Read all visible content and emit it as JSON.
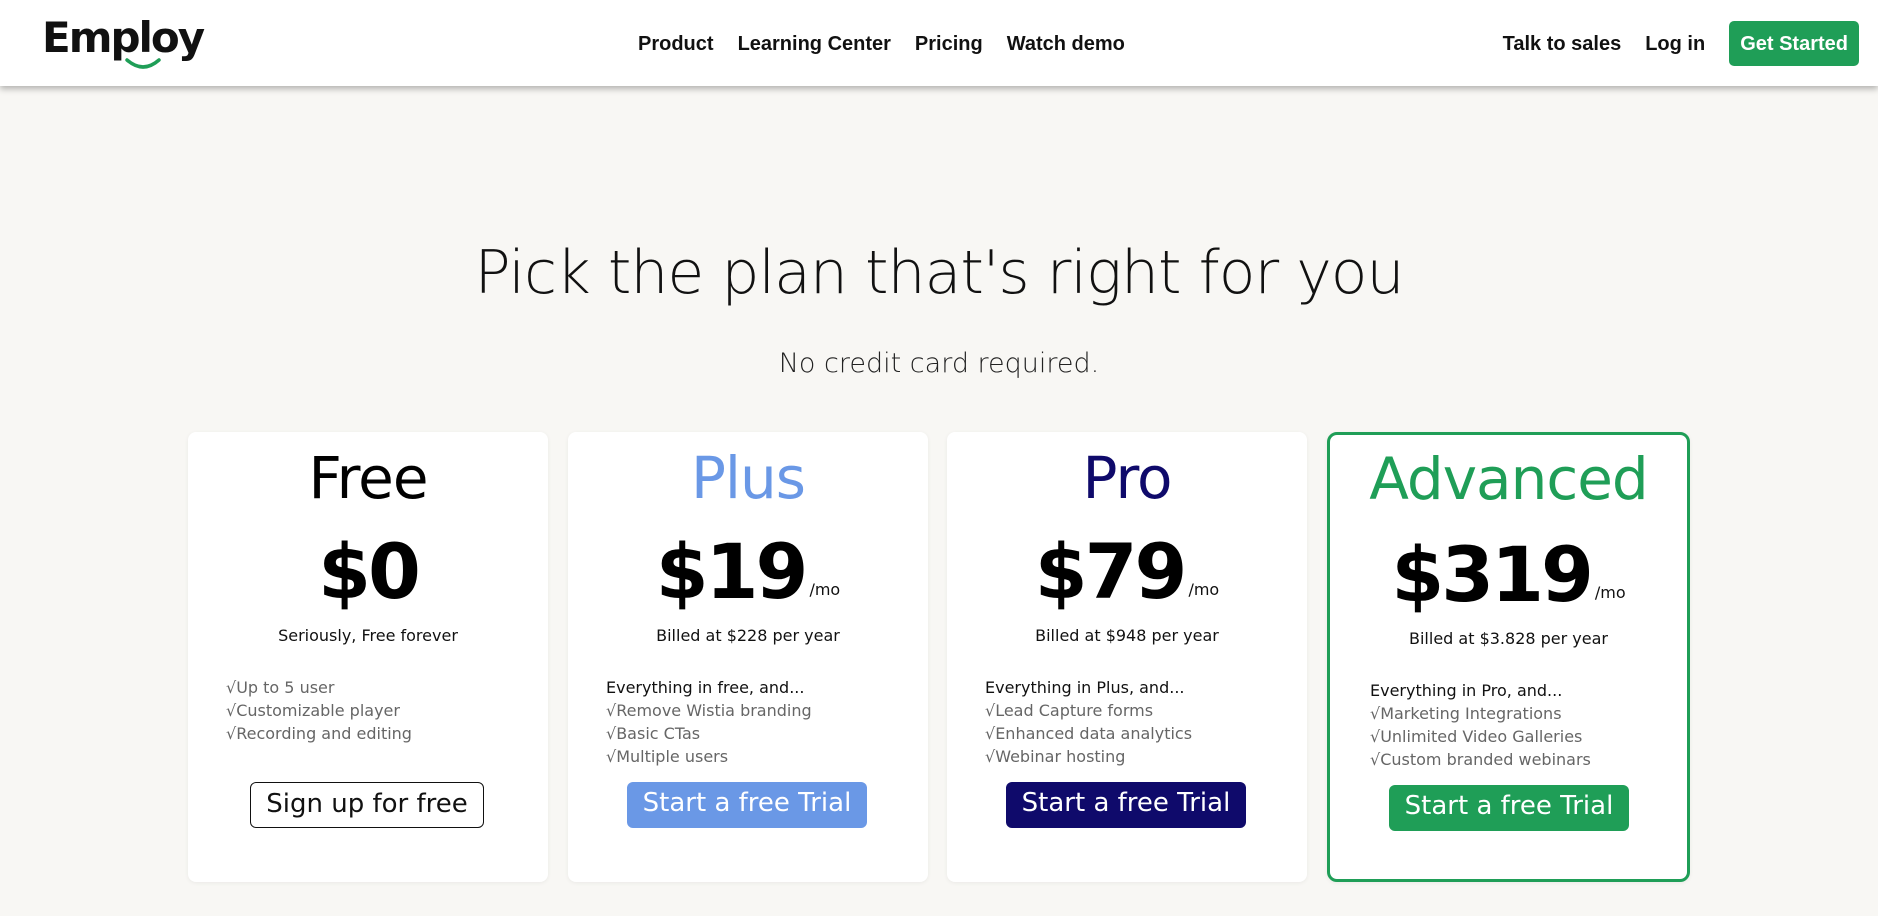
{
  "header": {
    "logo_text": "Employ",
    "nav": [
      "Product",
      "Learning Center",
      "Pricing",
      "Watch demo"
    ],
    "talk_to_sales": "Talk to sales",
    "log_in": "Log in",
    "get_started": "Get Started"
  },
  "hero": {
    "title": "Pick the plan that's right for you",
    "subtitle": "No credit card required."
  },
  "plans": [
    {
      "name": "Free",
      "price": "$0",
      "per": "",
      "billed": "Seriously, Free forever",
      "heading": "",
      "features": [
        "√Up to 5 user",
        "√Customizable player",
        "√Recording and editing"
      ],
      "cta": "Sign up for free"
    },
    {
      "name": "Plus",
      "price": "$19",
      "per": "/mo",
      "billed": "Billed at $228 per year",
      "heading": "Everything in free, and...",
      "features": [
        "√Remove Wistia branding",
        "√Basic CTas",
        "√Multiple users"
      ],
      "cta": "Start a free Trial"
    },
    {
      "name": "Pro",
      "price": "$79",
      "per": "/mo",
      "billed": "Billed at $948 per year",
      "heading": "Everything in Plus, and...",
      "features": [
        "√Lead Capture forms",
        "√Enhanced data analytics",
        "√Webinar hosting"
      ],
      "cta": "Start a free Trial"
    },
    {
      "name": "Advanced",
      "price": "$319",
      "per": "/mo",
      "billed": "Billed at $3.828 per year",
      "heading": "Everything in Pro, and...",
      "features": [
        "√Marketing Integrations",
        "√Unlimited Video Galleries",
        "√Custom branded webinars"
      ],
      "cta": "Start a free Trial"
    }
  ],
  "colors": {
    "brand_green": "#1f9e57",
    "plus_blue": "#6a98e6",
    "pro_navy": "#0f0a6b",
    "background": "#f8f7f4"
  }
}
